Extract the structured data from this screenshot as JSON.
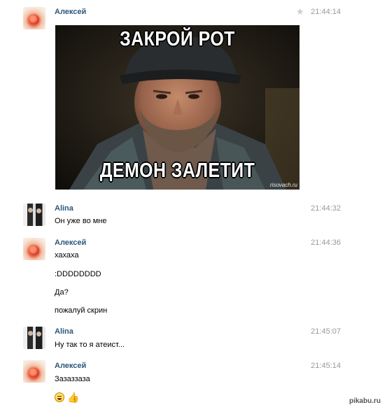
{
  "messages": [
    {
      "author": "Алексей",
      "time": "21:44:14",
      "meme": {
        "top_text": "ЗАКРОЙ РОТ",
        "bottom_text": "ДЕМОН ЗАЛЕТИТ",
        "watermark": "risovach.ru"
      }
    },
    {
      "author": "Alina",
      "time": "21:44:32",
      "lines": [
        "Он уже во мне"
      ]
    },
    {
      "author": "Алексей",
      "time": "21:44:36",
      "lines": [
        "хахаха",
        ":DDDDDDDD",
        "Да?",
        "пожалуй скрин"
      ]
    },
    {
      "author": "Alina",
      "time": "21:45:07",
      "lines": [
        "Ну так то я атеист..."
      ]
    },
    {
      "author": "Алексей",
      "time": "21:45:14",
      "lines": [
        "Зазаззаза"
      ],
      "emojis": [
        "grinning-face",
        "thumbs-up"
      ]
    }
  ],
  "icons": {
    "favorite": "star-icon"
  },
  "watermark": "pikabu.ru"
}
